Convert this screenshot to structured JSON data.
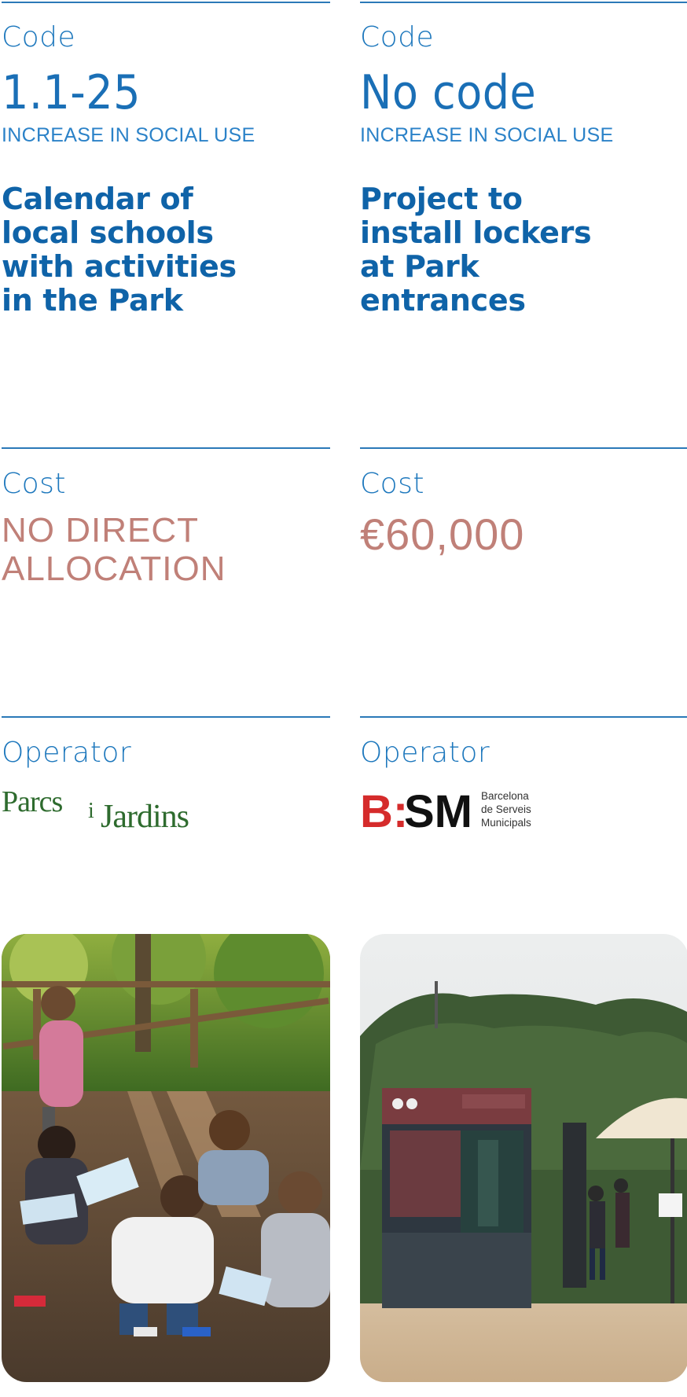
{
  "left": {
    "code_label": "Code",
    "code_value": "1.1-25",
    "category": "INCREASE IN SOCIAL USE",
    "title_lines": [
      "Calendar of",
      "local schools",
      "with activities",
      "in the Park"
    ],
    "cost_label": "Cost",
    "cost_lines": [
      "NO DIRECT",
      "ALLOCATION"
    ],
    "operator_label": "Operator",
    "operator_logo": {
      "text_part1": "Parcs",
      "text_part2": "i",
      "text_part3": "Jardins",
      "color": "#2e6b2e"
    },
    "photo_icon": "children-drawing-photo"
  },
  "right": {
    "code_label": "Code",
    "code_value": "No code",
    "category": "INCREASE IN SOCIAL USE",
    "title_lines": [
      "Project to",
      "install lockers",
      "at Park",
      "entrances"
    ],
    "cost_label": "Cost",
    "cost_value": "€60,000",
    "operator_label": "Operator",
    "operator_logo": {
      "mark": "B:SM",
      "text_lines": [
        "Barcelona",
        "de Serveis",
        "Municipals"
      ],
      "accent": "#d52b2b"
    },
    "photo_icon": "locker-kiosk-photo"
  },
  "colors": {
    "accent_blue": "#1e78bd",
    "title_blue": "#0f63a8",
    "cost_pink": "#c08078"
  }
}
